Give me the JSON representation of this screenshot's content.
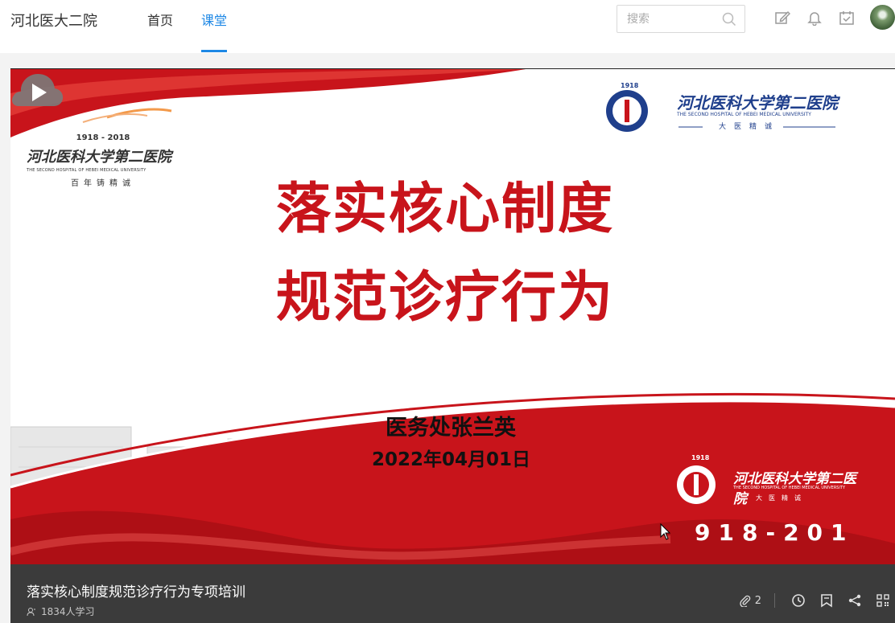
{
  "header": {
    "brand": "河北医大二院",
    "nav": [
      {
        "label": "首页",
        "active": false
      },
      {
        "label": "课堂",
        "active": true
      }
    ],
    "search_placeholder": "搜索",
    "icons": [
      "edit-icon",
      "bell-icon",
      "calendar-check-icon",
      "avatar"
    ],
    "accent_color": "#1e88e5"
  },
  "slide": {
    "title_line1": "落实核心制度",
    "title_line2": "规范诊疗行为",
    "presenter": "医务处张兰英",
    "date": "2022年04月01日",
    "logo_left": {
      "years": "1918 - 2018",
      "name": "河北医科大学第二医院",
      "english": "THE SECOND HOSPITAL OF HEBEI MEDICAL UNIVERSITY",
      "motto": "百年铸精诚"
    },
    "logo_right": {
      "year": "1918",
      "name": "河北医科大学第二医院",
      "english": "THE SECOND HOSPITAL OF HEBEI MEDICAL UNIVERSITY",
      "motto": "大医精诚"
    },
    "logo_bottom": {
      "year": "1918",
      "name": "河北医科大学第二医院",
      "english": "THE SECOND HOSPITAL OF HEBEI MEDICAL UNIVERSITY",
      "motto": "大医精诚"
    },
    "bottom_years": "918-201",
    "primary_red": "#c8141b"
  },
  "course": {
    "title": "落实核心制度规范诊疗行为专项培训",
    "learners": "1834人学习",
    "attachments": "2",
    "tools": [
      "history-icon",
      "bookmark-icon",
      "share-icon",
      "qrcode-icon"
    ]
  }
}
